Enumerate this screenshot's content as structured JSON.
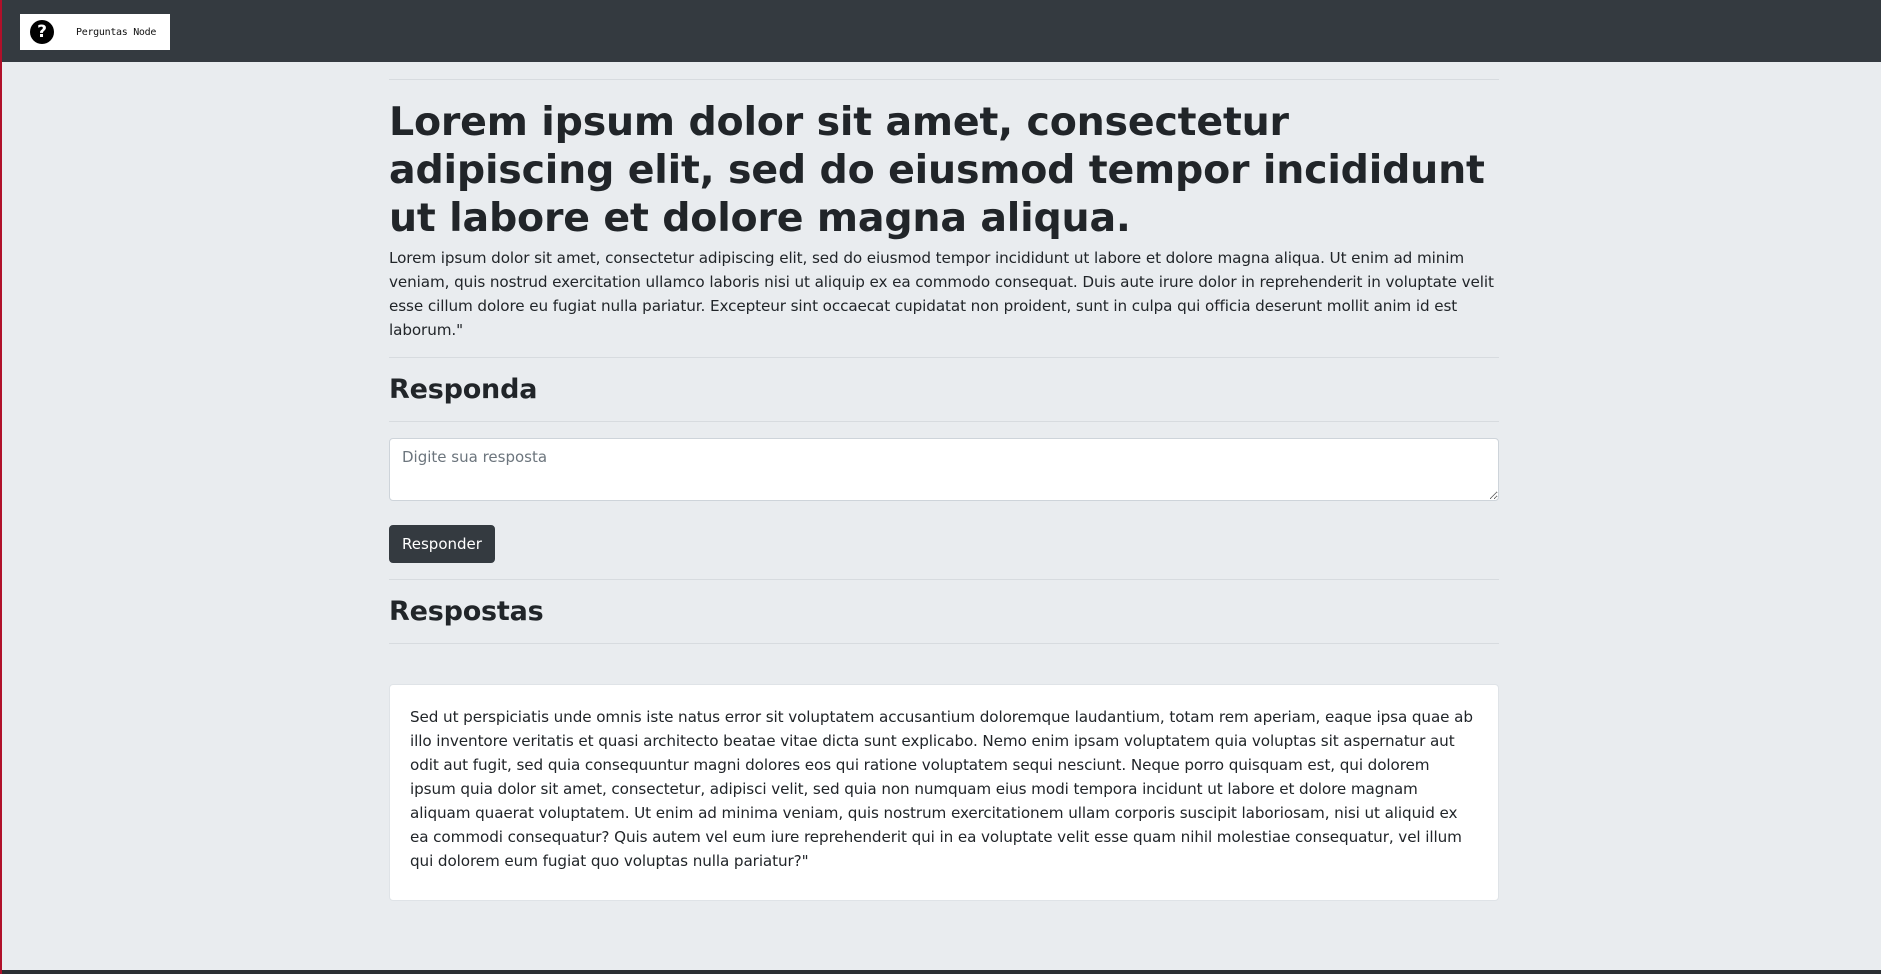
{
  "navbar": {
    "brand_icon_glyph": "?",
    "brand_text": "Perguntas Node"
  },
  "question": {
    "title": "Lorem ipsum dolor sit amet, consectetur adipiscing elit, sed do eiusmod tempor incididunt ut labore et dolore magna aliqua.",
    "description": "Lorem ipsum dolor sit amet, consectetur adipiscing elit, sed do eiusmod tempor incididunt ut labore et dolore magna aliqua. Ut enim ad minim veniam, quis nostrud exercitation ullamco laboris nisi ut aliquip ex ea commodo consequat. Duis aute irure dolor in reprehenderit in voluptate velit esse cillum dolore eu fugiat nulla pariatur. Excepteur sint occaecat cupidatat non proident, sunt in culpa qui officia deserunt mollit anim id est laborum.\""
  },
  "answer_form": {
    "heading": "Responda",
    "placeholder": "Digite sua resposta",
    "value": "",
    "submit_label": "Responder"
  },
  "answers": {
    "heading": "Respostas",
    "items": [
      {
        "text": "Sed ut perspiciatis unde omnis iste natus error sit voluptatem accusantium doloremque laudantium, totam rem aperiam, eaque ipsa quae ab illo inventore veritatis et quasi architecto beatae vitae dicta sunt explicabo. Nemo enim ipsam voluptatem quia voluptas sit aspernatur aut odit aut fugit, sed quia consequuntur magni dolores eos qui ratione voluptatem sequi nesciunt. Neque porro quisquam est, qui dolorem ipsum quia dolor sit amet, consectetur, adipisci velit, sed quia non numquam eius modi tempora incidunt ut labore et dolore magnam aliquam quaerat voluptatem. Ut enim ad minima veniam, quis nostrum exercitationem ullam corporis suscipit laboriosam, nisi ut aliquid ex ea commodi consequatur? Quis autem vel eum iure reprehenderit qui in ea voluptate velit esse quam nihil molestiae consequatur, vel illum qui dolorem eum fugiat quo voluptas nulla pariatur?\""
      }
    ]
  },
  "colors": {
    "navbar_bg": "#343a40",
    "page_bg": "#e9ecef",
    "button_bg": "#343a40",
    "text": "#212529"
  }
}
